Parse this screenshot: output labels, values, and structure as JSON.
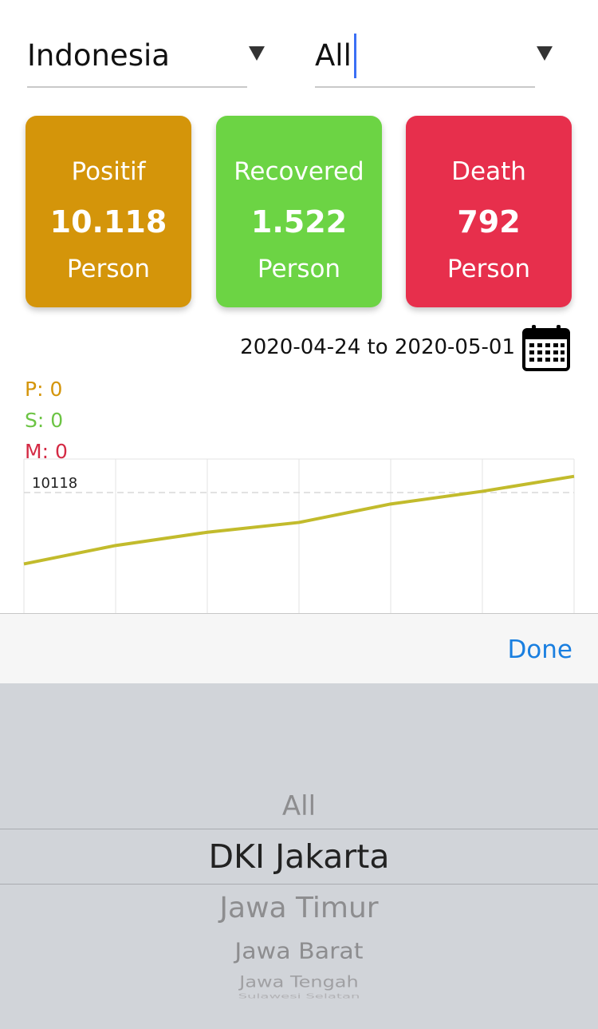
{
  "filters": {
    "country": "Indonesia",
    "region": "All"
  },
  "cards": [
    {
      "label": "Positif",
      "value": "10.118",
      "unit": "Person",
      "color": "#d4950a"
    },
    {
      "label": "Recovered",
      "value": "1.522",
      "unit": "Person",
      "color": "#6cd444"
    },
    {
      "label": "Death",
      "value": "792",
      "unit": "Person",
      "color": "#e72f4c"
    }
  ],
  "date_range": "2020-04-24 to 2020-05-01",
  "legend": {
    "p": "P: 0",
    "s": "S: 0",
    "m": "M: 0",
    "colors": {
      "p": "#d4950a",
      "s": "#6cc444",
      "m": "#d42a44"
    }
  },
  "chart_data": {
    "type": "line",
    "series": [
      {
        "values": [
          8880,
          9200,
          9430,
          9600,
          9920,
          10140,
          10400
        ],
        "color": "#c2bb2c"
      }
    ],
    "reference_line": {
      "value": 10118,
      "label": "10118"
    },
    "grid": true
  },
  "picker": {
    "done_label": "Done",
    "items": [
      "All",
      "DKI Jakarta",
      "Jawa Timur",
      "Jawa Barat",
      "Jawa Tengah",
      "Sulawesi Selatan"
    ],
    "selected_index": 1
  },
  "icons": {
    "dropdown": "triangle-down",
    "calendar": "calendar-icon"
  }
}
